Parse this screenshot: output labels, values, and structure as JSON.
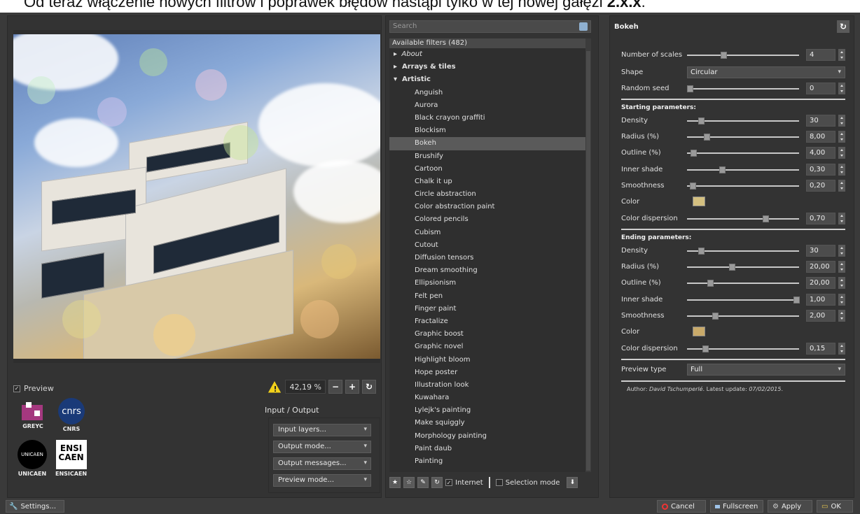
{
  "banner": {
    "prefix": "Od teraz włączenie nowych filtrów i poprawek błędów nastąpi tylko w tej nowej gałęzi ",
    "bold": "2.x.x",
    "suffix": "."
  },
  "preview": {
    "checkbox_label": "Preview",
    "zoom": "42,19 %"
  },
  "logos": {
    "greyc": "GREYC",
    "cnrs": "CNRS",
    "unicaen": "UNICAEN",
    "ensicaen": "ENSICAEN",
    "cnrs_mark": "cnrs",
    "ensi_mark": "ENSI CAEN",
    "unicaen_mark": "UNICAEN"
  },
  "io": {
    "title": "Input / Output",
    "input_layers": "Input layers...",
    "output_mode": "Output mode...",
    "output_messages": "Output messages...",
    "preview_mode": "Preview mode..."
  },
  "settings_label": "Settings...",
  "filters": {
    "search_placeholder": "Search",
    "header": "Available filters (482)",
    "categories": [
      {
        "label": "About"
      },
      {
        "label": "Arrays & tiles"
      },
      {
        "label": "Artistic"
      }
    ],
    "items": [
      "Anguish",
      "Aurora",
      "Black crayon graffiti",
      "Blockism",
      "Bokeh",
      "Brushify",
      "Cartoon",
      "Chalk it up",
      "Circle abstraction",
      "Color abstraction paint",
      "Colored pencils",
      "Cubism",
      "Cutout",
      "Diffusion tensors",
      "Dream smoothing",
      "Ellipsionism",
      "Felt pen",
      "Finger paint",
      "Fractalize",
      "Graphic boost",
      "Graphic novel",
      "Highlight bloom",
      "Hope poster",
      "Illustration look",
      "Kuwahara",
      "Lylejk's painting",
      "Make squiggly",
      "Morphology painting",
      "Paint daub",
      "Painting"
    ],
    "internet_label": "Internet",
    "selection_mode_label": "Selection mode"
  },
  "params": {
    "title": "Bokeh",
    "number_of_scales": {
      "label": "Number of scales",
      "value": "4"
    },
    "shape": {
      "label": "Shape",
      "value": "Circular"
    },
    "random_seed": {
      "label": "Random seed",
      "value": "0"
    },
    "starting_header": "Starting parameters:",
    "start": {
      "density": {
        "label": "Density",
        "value": "30"
      },
      "radius": {
        "label": "Radius (%)",
        "value": "8,00"
      },
      "outline": {
        "label": "Outline (%)",
        "value": "4,00"
      },
      "inner_shade": {
        "label": "Inner shade",
        "value": "0,30"
      },
      "smoothness": {
        "label": "Smoothness",
        "value": "0,20"
      },
      "color": {
        "label": "Color"
      },
      "color_dispersion": {
        "label": "Color dispersion",
        "value": "0,70"
      }
    },
    "ending_header": "Ending parameters:",
    "end": {
      "density": {
        "label": "Density",
        "value": "30"
      },
      "radius": {
        "label": "Radius (%)",
        "value": "20,00"
      },
      "outline": {
        "label": "Outline (%)",
        "value": "20,00"
      },
      "inner_shade": {
        "label": "Inner shade",
        "value": "1,00"
      },
      "smoothness": {
        "label": "Smoothness",
        "value": "2,00"
      },
      "color": {
        "label": "Color"
      },
      "color_dispersion": {
        "label": "Color dispersion",
        "value": "0,15"
      }
    },
    "preview_type": {
      "label": "Preview type",
      "value": "Full"
    },
    "author_prefix": "Author: ",
    "author_name": "David Tschumperlé",
    "update_prefix": ". Latest update: ",
    "update_date": "07/02/2015",
    "update_suffix": "."
  },
  "buttons": {
    "cancel": "Cancel",
    "fullscreen": "Fullscreen",
    "apply": "Apply",
    "ok": "OK"
  }
}
